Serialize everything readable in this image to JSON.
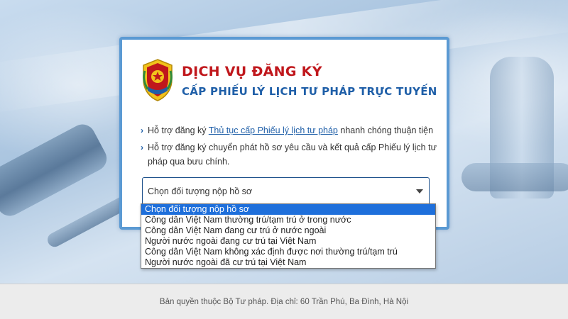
{
  "header": {
    "title_line1": "DỊCH VỤ ĐĂNG KÝ",
    "title_line2": "CẤP PHIẾU LÝ LỊCH TƯ PHÁP TRỰC TUYẾN"
  },
  "bullets": [
    {
      "prefix": "Hỗ trợ đăng ký ",
      "link": "Thủ tục cấp Phiếu lý lịch tư pháp",
      "suffix": " nhanh chóng thuận tiện"
    },
    {
      "text": "Hỗ trợ đăng ký chuyển phát hồ sơ yêu cầu và kết quả cấp Phiếu lý lịch tư pháp qua bưu chính."
    }
  ],
  "select": {
    "current_value": "Chọn đối tượng nộp hồ sơ",
    "options": [
      "Chọn đối tượng nộp hồ sơ",
      "Công dân Việt Nam thường trú/tạm trú ở trong nước",
      "Công dân Việt Nam đang cư trú ở nước ngoài",
      "Người nước ngoài đang cư trú tại Việt Nam",
      "Công dân Việt Nam không xác định được nơi thường trú/tạm trú",
      "Người nước ngoài đã cư trú tại Việt Nam"
    ],
    "highlighted_index": 0
  },
  "footer": {
    "text": "Bản quyền thuộc Bộ Tư pháp. Địa chỉ: 60 Trần Phú, Ba Đình, Hà Nội"
  },
  "colors": {
    "title_red": "#c0171c",
    "title_blue": "#1f5fa8",
    "card_border": "#5b9ad3",
    "option_highlight": "#1e6fdb"
  },
  "icons": {
    "emblem": "police-emblem-icon",
    "bullet": "chevron-right-icon",
    "select_caret": "caret-down-icon"
  }
}
